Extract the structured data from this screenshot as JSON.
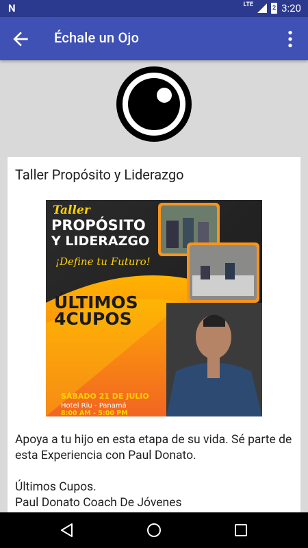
{
  "status_bar": {
    "notification_icon": "N",
    "network": "LTE",
    "battery_level": "2",
    "time": "3:20"
  },
  "app_bar": {
    "title": "Échale un Ojo",
    "back_icon": "arrow-back-icon",
    "menu_icon": "more-vert-icon"
  },
  "post": {
    "title": "Taller Propósito y Liderazgo",
    "poster": {
      "top_label": "Taller",
      "headline_1": "PROPÓSITO",
      "headline_2": "Y LIDERAZGO",
      "tagline": "¡Define tu Futuro!",
      "cupos_1": "ÚLTIMOS",
      "cupos_2": "4CUPOS",
      "date": "SÁBADO 21 DE JULIO",
      "venue": "Hotel Riu - Panamá",
      "hours": "8:00 AM - 5:00 PM"
    },
    "paragraph_1": "Apoya a tu hijo en esta etapa de su vida. Sé parte de esta Experiencia con Paul Donato.",
    "line_2": "Últimos Cupos.",
    "line_3": "Paul Donato Coach De Jóvenes"
  },
  "colors": {
    "status_bar": "#2b3a8f",
    "app_bar": "#3f51b5",
    "background": "#d9d9d9",
    "poster_orange": "#f7941d",
    "poster_yellow": "#ffd200"
  }
}
